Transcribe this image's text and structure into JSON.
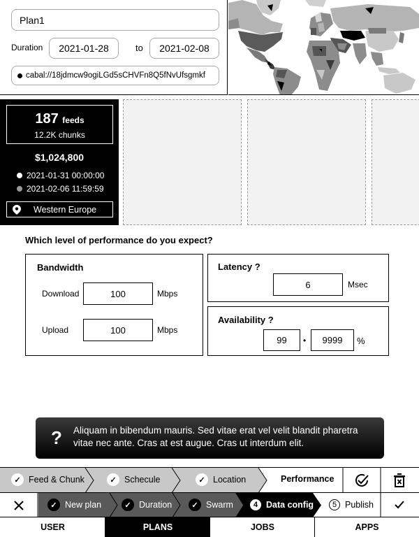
{
  "plan": {
    "name": "Plan1",
    "duration_label": "Duration",
    "date_from": "2021-01-28",
    "to_label": "to",
    "date_to": "2021-02-08",
    "address": "cabal://18jdmcw9ogiLGd5sCHVFn8Q5fNvUfsgmkf"
  },
  "stats": {
    "feeds_count": "187",
    "feeds_unit": "feeds",
    "chunks": "12.2K chunks",
    "amount": "$1,024,800",
    "timestamps": [
      "2021-01-31 00:00:00",
      "2021-02-06 11:59:59"
    ],
    "region": "Western Europe"
  },
  "performance": {
    "question": "Which level of performance do you expect?",
    "bandwidth_title": "Bandwidth",
    "download_label": "Download",
    "download_value": "100",
    "upload_label": "Upload",
    "upload_value": "100",
    "unit_mbps": "Mbps",
    "latency_title": "Latency ?",
    "latency_value": "6",
    "latency_unit": "Msec",
    "availability_title": "Availability ?",
    "availability_int": "99",
    "availability_sep": "•",
    "availability_dec": "9999",
    "availability_unit": "%"
  },
  "tip": {
    "icon": "?",
    "text": "Aliquam in bibendum mauris. Sed vitae erat vel velit blandit pharetra vitae nec ante. Cras at est augue. Cras ut interdum elit."
  },
  "steps_top": [
    "Feed & Chunk",
    "Schecule",
    "Location",
    "Performance"
  ],
  "steps_bottom": [
    "New plan",
    "Duration",
    "Swarm",
    "Data config",
    "Publish"
  ],
  "step_numbers": [
    "4",
    "5"
  ],
  "tabs": [
    "USER",
    "PLANS",
    "JOBS",
    "APPS"
  ],
  "colors": {
    "dark": "#000000",
    "mid": "#595959",
    "light": "#c8c8c8"
  }
}
